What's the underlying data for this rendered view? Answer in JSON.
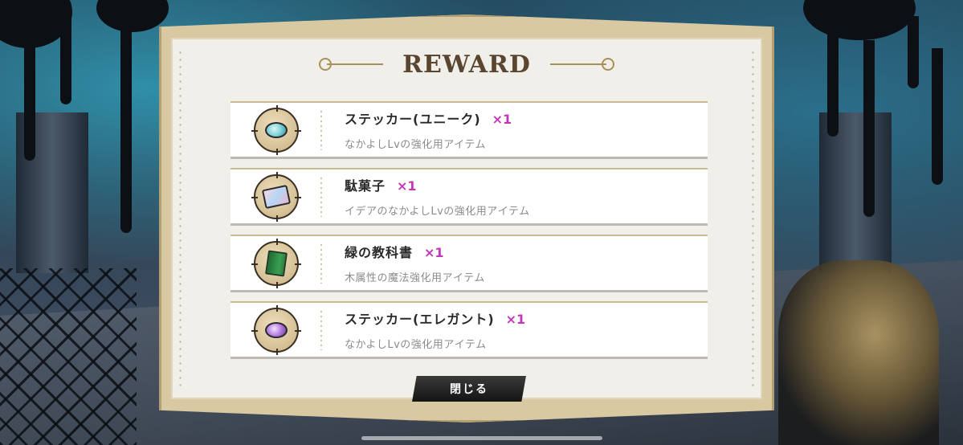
{
  "title": "REWARD",
  "rewards": [
    {
      "name": "ステッカー(ユニーク)",
      "qty": "×1",
      "desc": "なかよしLvの強化用アイテム",
      "icon": "sticker-unique-icon"
    },
    {
      "name": "駄菓子",
      "qty": "×1",
      "desc": "イデアのなかよしLvの強化用アイテム",
      "icon": "snack-icon"
    },
    {
      "name": "緑の教科書",
      "qty": "×1",
      "desc": "木属性の魔法強化用アイテム",
      "icon": "green-textbook-icon"
    },
    {
      "name": "ステッカー(エレガント)",
      "qty": "×1",
      "desc": "なかよしLvの強化用アイテム",
      "icon": "sticker-elegant-icon"
    }
  ],
  "close_button": {
    "label": "閉じる"
  },
  "colors": {
    "qty_accent": "#c236b8",
    "frame_gold": "#b39f72",
    "panel_bg": "#f1efea"
  }
}
